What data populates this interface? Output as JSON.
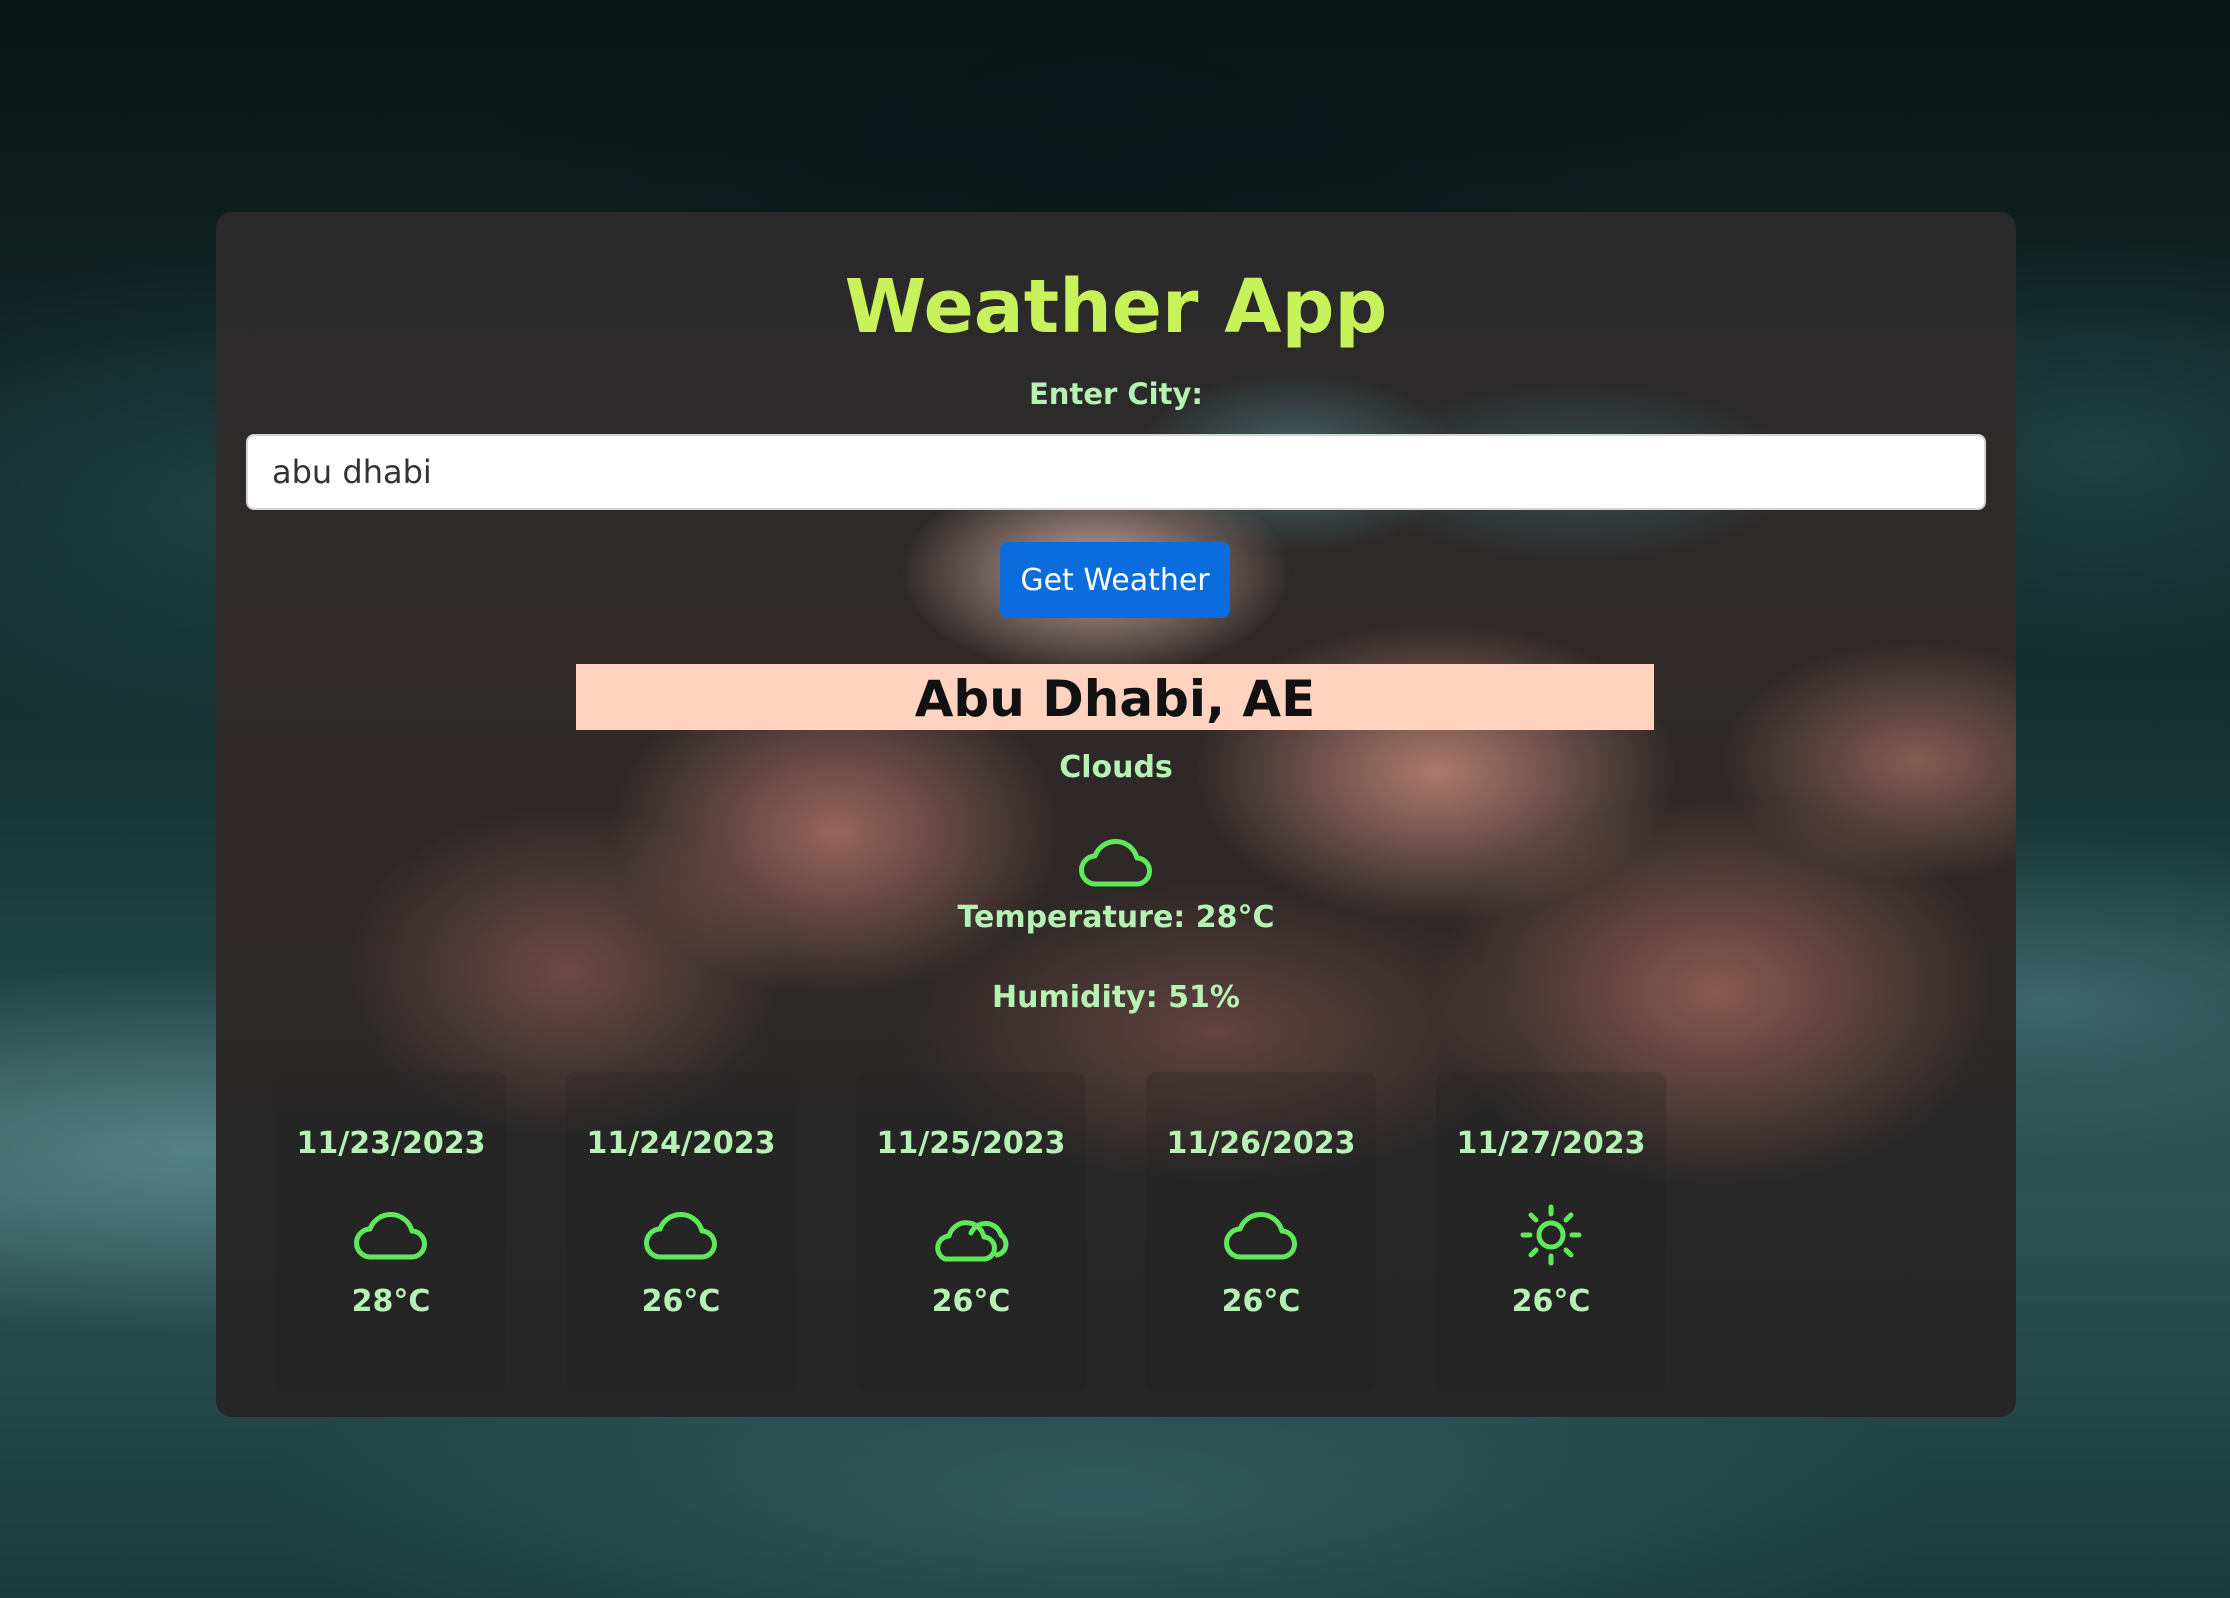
{
  "app": {
    "title": "Weather App"
  },
  "search": {
    "label": "Enter City:",
    "value": "abu dhabi",
    "button_label": "Get Weather"
  },
  "current": {
    "city": "Abu Dhabi, AE",
    "condition": "Clouds",
    "icon": "cloud-icon",
    "temperature_text": "Temperature: 28°C",
    "humidity_text": "Humidity: 51%"
  },
  "forecast": [
    {
      "date": "11/23/2023",
      "icon": "cloud-icon",
      "temp": "28°C"
    },
    {
      "date": "11/24/2023",
      "icon": "cloud-icon",
      "temp": "26°C"
    },
    {
      "date": "11/25/2023",
      "icon": "clouds-icon",
      "temp": "26°C"
    },
    {
      "date": "11/26/2023",
      "icon": "cloud-icon",
      "temp": "26°C"
    },
    {
      "date": "11/27/2023",
      "icon": "sun-icon",
      "temp": "26°C"
    }
  ],
  "colors": {
    "title": "#c8f25a",
    "text": "#b6f2b4",
    "icon": "#5fe85a",
    "button": "#0b6cde",
    "city_highlight": "#ffd3bf"
  }
}
